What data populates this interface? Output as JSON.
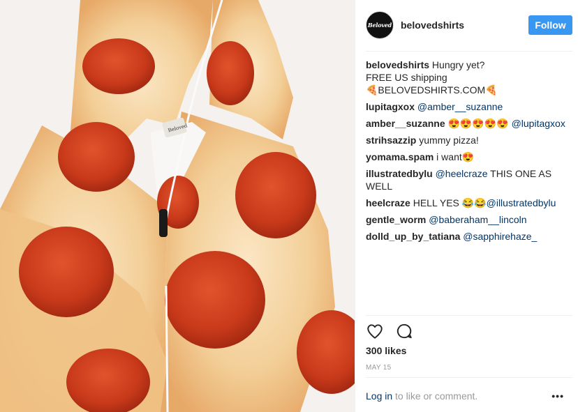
{
  "post": {
    "username": "belovedshirts",
    "avatar_text": "Beloved",
    "follow_label": "Follow",
    "photo_alt": "Pizza print zip-up hoodie",
    "hoodie_tag_text": "Beloved"
  },
  "caption": {
    "username": "belovedshirts",
    "line1": "Hungry yet?",
    "line2": "FREE US shipping",
    "line3": "🍕BELOVEDSHIRTS.COM🍕"
  },
  "comments": [
    {
      "user": "lupitagxox",
      "pre": "",
      "mention": "@amber__suzanne",
      "post": ""
    },
    {
      "user": "amber__suzanne",
      "pre": "😍😍😍😍😍 ",
      "mention": "@lupitagxox",
      "post": ""
    },
    {
      "user": "strihsazzip",
      "pre": "yummy pizza!",
      "mention": "",
      "post": ""
    },
    {
      "user": "yomama.spam",
      "pre": "i want😍",
      "mention": "",
      "post": ""
    },
    {
      "user": "illustratedbylu",
      "pre": "",
      "mention": "@heelcraze",
      "post": " THIS ONE AS WELL"
    },
    {
      "user": "heelcraze",
      "pre": "HELL YES 😂😂",
      "mention": "@illustratedbylu",
      "post": ""
    },
    {
      "user": "gentle_worm",
      "pre": "",
      "mention": "@baberaham__lincoln",
      "post": ""
    },
    {
      "user": "dolld_up_by_tatiana",
      "pre": "",
      "mention": "@sapphirehaze_",
      "post": ""
    }
  ],
  "actions": {
    "like_icon": "heart-icon",
    "comment_icon": "comment-bubble-icon",
    "likes_text": "300 likes",
    "date_text": "MAY 15"
  },
  "footer": {
    "login_link": "Log in",
    "login_rest": " to like or comment.",
    "more_label": "•••"
  },
  "colors": {
    "follow_blue": "#3897f0",
    "mention": "#003569",
    "muted": "#999999"
  }
}
